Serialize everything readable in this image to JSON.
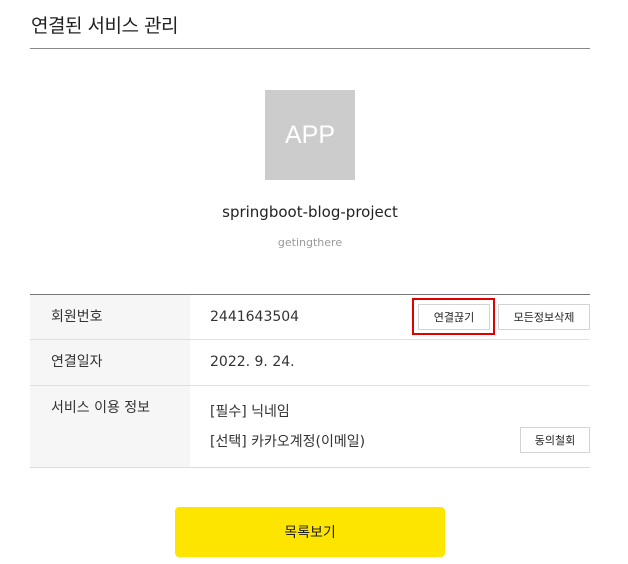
{
  "page": {
    "title": "연결된 서비스 관리"
  },
  "app": {
    "icon_text": "APP",
    "name": "springboot-blog-project",
    "subtitle": "getingthere"
  },
  "info": {
    "member_label": "회원번호",
    "member_value": "2441643504",
    "disconnect_label": "연결끊기",
    "delete_all_label": "모든정보삭제",
    "connected_date_label": "연결일자",
    "connected_date_value": "2022. 9. 24.",
    "usage_label": "서비스 이용 정보",
    "required_item": "[필수] 닉네임",
    "optional_item": "[선택] 카카오계정(이메일)",
    "withdraw_label": "동의철회"
  },
  "footer": {
    "list_button": "목록보기"
  },
  "colors": {
    "accent": "#fee500",
    "highlight": "#e00000"
  }
}
